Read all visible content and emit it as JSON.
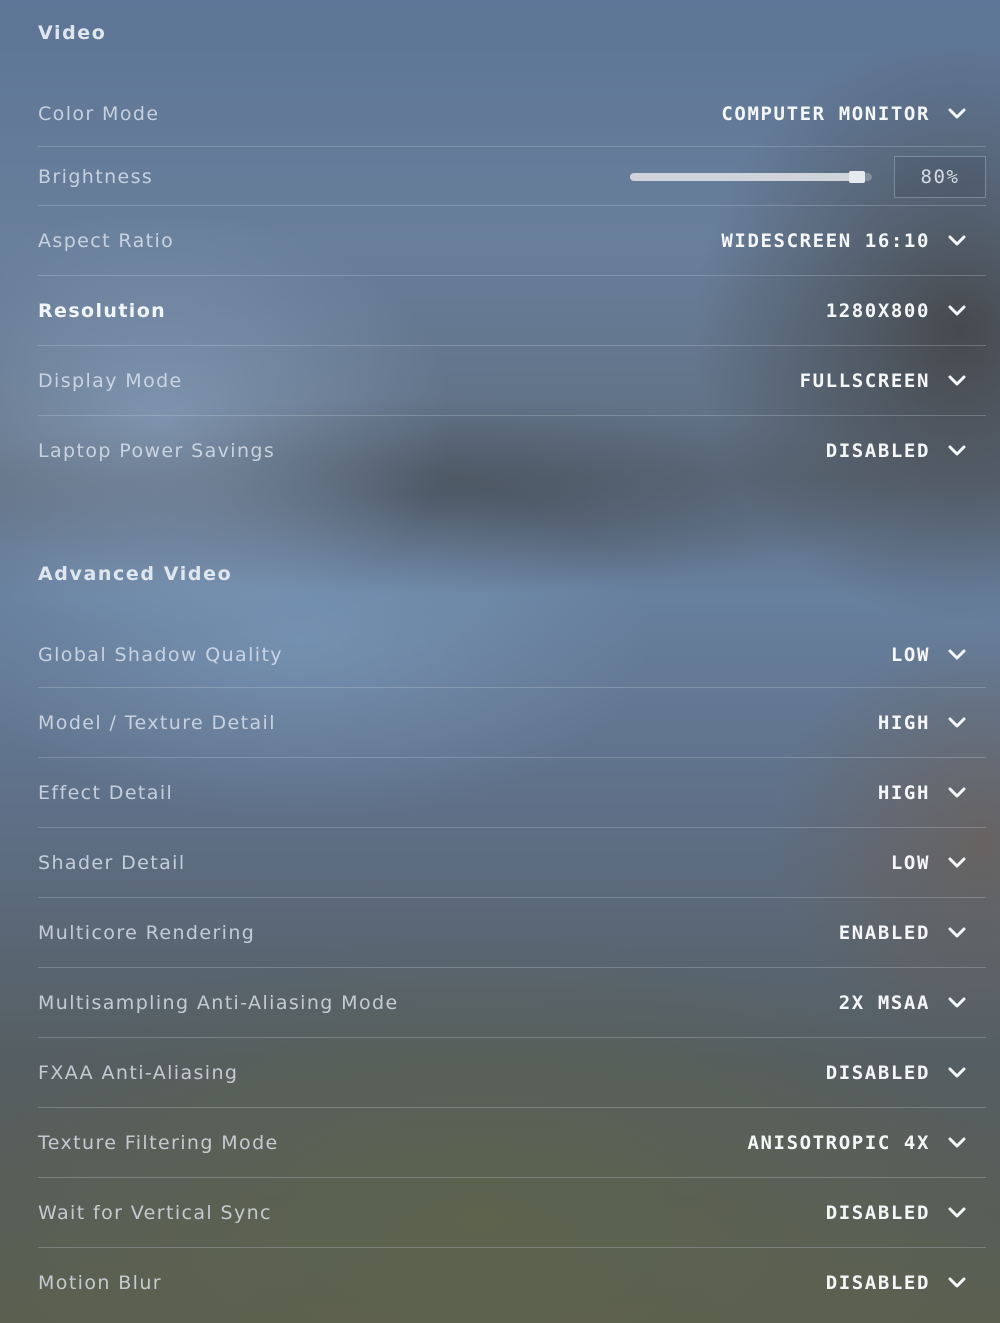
{
  "video": {
    "title": "Video",
    "color_mode": {
      "label": "Color Mode",
      "value": "COMPUTER MONITOR"
    },
    "brightness": {
      "label": "Brightness",
      "value_text": "80%",
      "level_fraction": 0.97
    },
    "aspect_ratio": {
      "label": "Aspect Ratio",
      "value": "WIDESCREEN 16:10"
    },
    "resolution": {
      "label": "Resolution",
      "value": "1280X800"
    },
    "display_mode": {
      "label": "Display Mode",
      "value": "FULLSCREEN"
    },
    "laptop_power_savings": {
      "label": "Laptop Power Savings",
      "value": "DISABLED"
    }
  },
  "advanced_video": {
    "title": "Advanced Video",
    "global_shadow_quality": {
      "label": "Global Shadow Quality",
      "value": "LOW"
    },
    "model_texture_detail": {
      "label": "Model / Texture Detail",
      "value": "HIGH"
    },
    "effect_detail": {
      "label": "Effect Detail",
      "value": "HIGH"
    },
    "shader_detail": {
      "label": "Shader Detail",
      "value": "LOW"
    },
    "multicore_rendering": {
      "label": "Multicore Rendering",
      "value": "ENABLED"
    },
    "msaa_mode": {
      "label": "Multisampling Anti-Aliasing Mode",
      "value": "2X MSAA"
    },
    "fxaa": {
      "label": "FXAA Anti-Aliasing",
      "value": "DISABLED"
    },
    "texture_filtering": {
      "label": "Texture Filtering Mode",
      "value": "ANISOTROPIC 4X"
    },
    "vsync": {
      "label": "Wait for Vertical Sync",
      "value": "DISABLED"
    },
    "motion_blur": {
      "label": "Motion Blur",
      "value": "DISABLED"
    }
  },
  "icons": {
    "dropdown": "chevron-down-icon"
  },
  "colors": {
    "text_primary": "#f4f6f8",
    "text_label": "#dfe6ee"
  }
}
